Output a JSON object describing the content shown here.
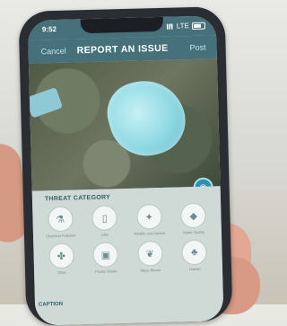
{
  "status": {
    "time": "9:52",
    "carrier": "LTE"
  },
  "nav": {
    "cancel": "Cancel",
    "title": "REPORT AN ISSUE",
    "post": "Post"
  },
  "threat": {
    "heading": "THREAT CATEGORY",
    "categories": [
      {
        "label": "Chemical Pollution",
        "icon": "flask-icon"
      },
      {
        "label": "Litter",
        "icon": "bottle-icon"
      },
      {
        "label": "Wildlife and Habitat",
        "icon": "bird-icon"
      },
      {
        "label": "Water Quality",
        "icon": "drop-icon"
      },
      {
        "label": "Other",
        "icon": "plant-icon"
      },
      {
        "label": "Plastic Waste",
        "icon": "bag-icon"
      },
      {
        "label": "Algae Bloom",
        "icon": "leaf-icon"
      },
      {
        "label": "Habitat",
        "icon": "tree-icon"
      }
    ]
  },
  "section2": {
    "heading": "CAPTION"
  },
  "colors": {
    "header": "#46707a",
    "accent": "#2f8fb0"
  }
}
